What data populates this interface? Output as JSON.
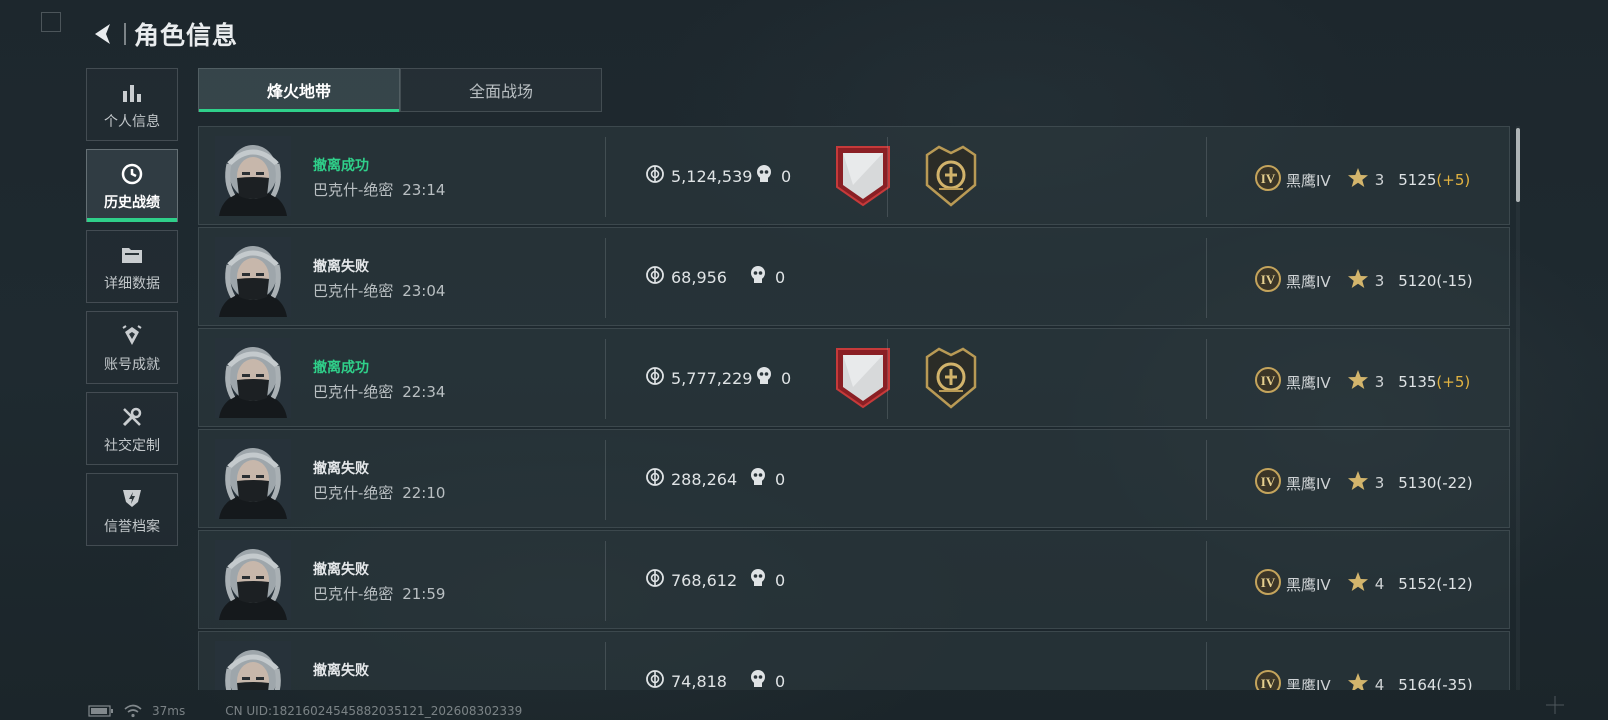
{
  "header": {
    "title": "角色信息"
  },
  "sidebar": {
    "items": [
      {
        "label": "个人信息",
        "icon": "bar-chart-icon"
      },
      {
        "label": "历史战绩",
        "icon": "history-clock-icon",
        "active": true
      },
      {
        "label": "详细数据",
        "icon": "folder-icon"
      },
      {
        "label": "账号成就",
        "icon": "achievement-icon"
      },
      {
        "label": "社交定制",
        "icon": "tools-icon"
      },
      {
        "label": "信誉档案",
        "icon": "shield-lightning-icon"
      }
    ]
  },
  "tabs": [
    {
      "label": "烽火地带",
      "active": true
    },
    {
      "label": "全面战场",
      "active": false
    }
  ],
  "matches": [
    {
      "status": "撤离成功",
      "success": true,
      "map": "巴克什-绝密",
      "time": "23:14",
      "value": "5,124,539",
      "kills": "0",
      "badges": true,
      "rank": "黑鹰IV",
      "level": "3",
      "score": "5125",
      "delta": "(+5)"
    },
    {
      "status": "撤离失败",
      "success": false,
      "map": "巴克什-绝密",
      "time": "23:04",
      "value": "68,956",
      "kills": "0",
      "badges": false,
      "rank": "黑鹰IV",
      "level": "3",
      "score": "5120",
      "delta": "(-15)"
    },
    {
      "status": "撤离成功",
      "success": true,
      "map": "巴克什-绝密",
      "time": "22:34",
      "value": "5,777,229",
      "kills": "0",
      "badges": true,
      "rank": "黑鹰IV",
      "level": "3",
      "score": "5135",
      "delta": "(+5)"
    },
    {
      "status": "撤离失败",
      "success": false,
      "map": "巴克什-绝密",
      "time": "22:10",
      "value": "288,264",
      "kills": "0",
      "badges": false,
      "rank": "黑鹰IV",
      "level": "3",
      "score": "5130",
      "delta": "(-22)"
    },
    {
      "status": "撤离失败",
      "success": false,
      "map": "巴克什-绝密",
      "time": "21:59",
      "value": "768,612",
      "kills": "0",
      "badges": false,
      "rank": "黑鹰IV",
      "level": "4",
      "score": "5152",
      "delta": "(-12)"
    },
    {
      "status": "撤离失败",
      "success": false,
      "map": "",
      "time": "",
      "value": "74,818",
      "kills": "0",
      "badges": false,
      "rank": "黑鹰IV",
      "level": "4",
      "score": "5164",
      "delta": "(-35)"
    }
  ],
  "footer": {
    "ping": "37ms",
    "uid": "CN UID:18216024545882035121_202608302339"
  },
  "colors": {
    "accent": "#2fd08a",
    "positive_delta": "#e2b341",
    "background": "#1f2a30"
  }
}
